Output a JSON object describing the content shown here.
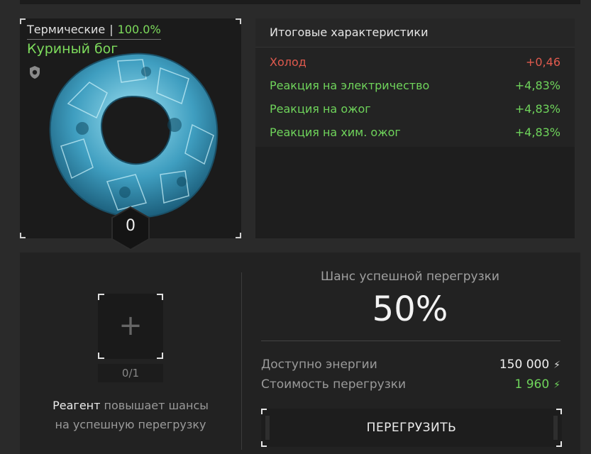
{
  "artifact": {
    "type": "Термические",
    "quality": "100.0%",
    "name": "Куриный бог",
    "level": "0",
    "icons": {
      "protection": "shield-icon",
      "image": "crystal-ring-artifact"
    }
  },
  "stats": {
    "title": "Итоговые характеристики",
    "rows": [
      {
        "name": "Холод",
        "value": "+0,46",
        "status": "negative"
      },
      {
        "name": "Реакция на электричество",
        "value": "+4,83%",
        "status": "positive"
      },
      {
        "name": "Реакция на ожог",
        "value": "+4,83%",
        "status": "positive"
      },
      {
        "name": "Реакция на хим. ожог",
        "value": "+4,83%",
        "status": "positive"
      }
    ]
  },
  "reagent": {
    "slot_icon": "plus-icon",
    "count": "0/1",
    "hint_bold": "Реагент",
    "hint_line1_rest": " повышает шансы",
    "hint_line2": "на успешную перегрузку"
  },
  "overload": {
    "chance_label": "Шанс успешной перегрузки",
    "chance_value": "50%",
    "energy_label": "Доступно энергии",
    "energy_value": "150 000",
    "cost_label": "Стоимость перегрузки",
    "cost_value": "1 960",
    "button_label": "ПЕРЕГРУЗИТЬ"
  },
  "colors": {
    "positive": "#6fd45b",
    "negative": "#e05a4e",
    "quality": "#7ddb5c"
  }
}
